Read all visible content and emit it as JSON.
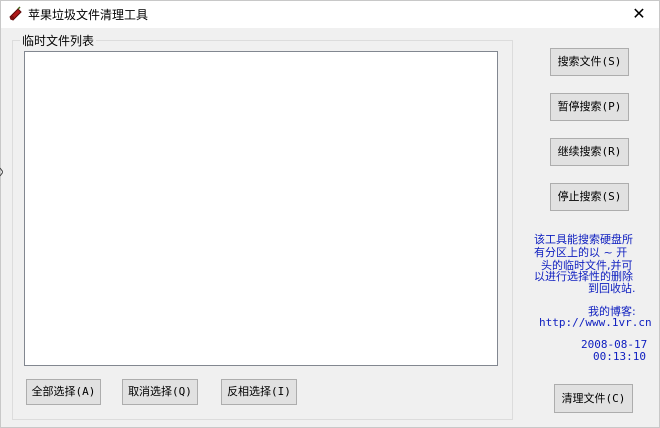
{
  "window": {
    "title": "苹果垃圾文件清理工具"
  },
  "group": {
    "label": "临时文件列表"
  },
  "buttons": {
    "search": "搜索文件(S)",
    "pause": "暂停搜索(P)",
    "resume": "继续搜索(R)",
    "stop": "停止搜索(S)",
    "select_all": "全部选择(A)",
    "deselect": "取消选择(Q)",
    "invert": "反相选择(I)",
    "clean": "清理文件(C)"
  },
  "info": {
    "line1": "该工具能搜索硬盘所",
    "line2": "有分区上的以 ~ 开",
    "line3": "头的临时文件,并可",
    "line4": "以进行选择性的删除",
    "line5": "到回收站.",
    "blog_label": "我的博客:",
    "blog_url": "http://www.1vr.cn",
    "date": "2008-08-17",
    "time": "00:13:10"
  },
  "colors": {
    "info_text": "#1020c0",
    "face": "#f0f0f0",
    "button": "#e1e1e1"
  },
  "icons": {
    "app": "apple-icon",
    "close": "close-icon"
  }
}
